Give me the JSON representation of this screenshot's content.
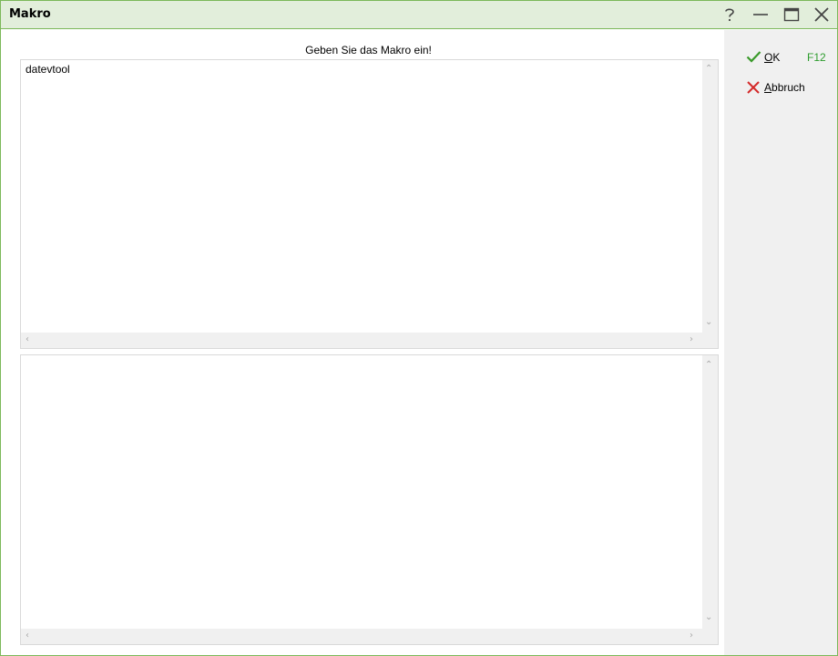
{
  "window": {
    "title": "Makro",
    "buttons": {
      "help": "help-icon",
      "minimize": "minimize-icon",
      "maximize": "maximize-icon",
      "close": "close-icon"
    }
  },
  "main": {
    "prompt": "Geben Sie das Makro ein!",
    "macro_input_value": "datevtool",
    "output_value": ""
  },
  "sidebar": {
    "ok": {
      "mnemonic": "O",
      "rest": "K",
      "shortcut": "F12",
      "icon": "check-icon",
      "icon_color": "#3a9a2a"
    },
    "cancel": {
      "mnemonic": "A",
      "rest": "bbruch",
      "icon": "cross-icon",
      "icon_color": "#d42a2a"
    }
  },
  "colors": {
    "border": "#7cb85a",
    "titlebar": "#e2eedb",
    "sidebar": "#f0f0f0",
    "shortcut": "#2e9d2e"
  }
}
